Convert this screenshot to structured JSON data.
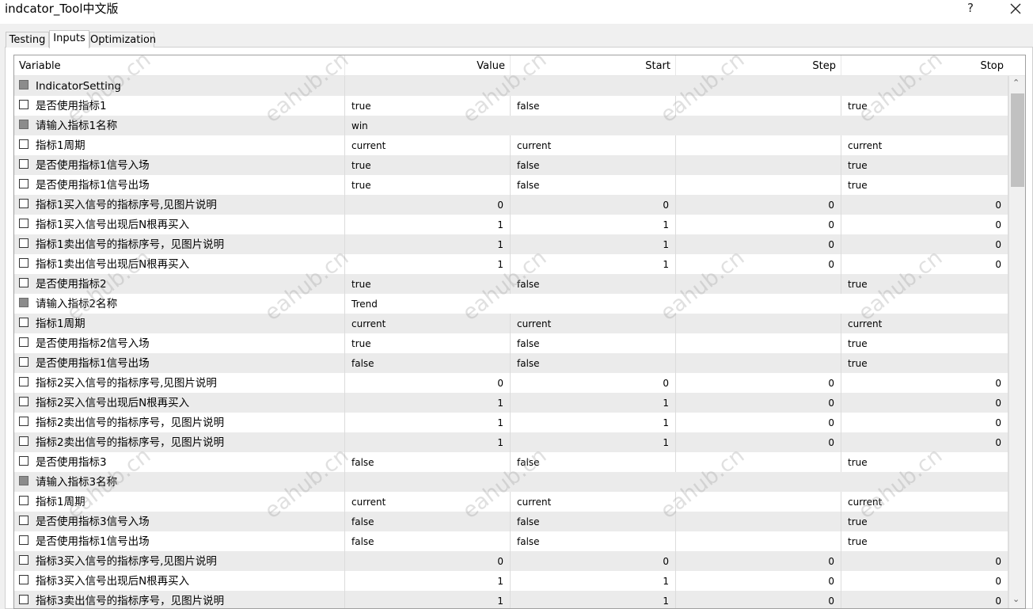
{
  "window": {
    "title": "indcator_Tool中文版",
    "help_label": "?"
  },
  "tabs": [
    {
      "label": "Testing"
    },
    {
      "label": "Inputs"
    },
    {
      "label": "Optimization"
    }
  ],
  "columns": [
    "Variable",
    "Value",
    "Start",
    "Step",
    "Stop"
  ],
  "rows": [
    {
      "kind": "group",
      "checkbox": "grey",
      "variable": "IndicatorSetting",
      "value": "",
      "start": "",
      "step": "",
      "stop": ""
    },
    {
      "kind": "text",
      "checkbox": "empty",
      "variable": "是否使用指标1",
      "value": "true",
      "start": "false",
      "step": "",
      "stop": "true"
    },
    {
      "kind": "group",
      "checkbox": "grey",
      "variable": "请输入指标1名称",
      "value": "win",
      "start": "",
      "step": "",
      "stop": ""
    },
    {
      "kind": "text",
      "checkbox": "empty",
      "variable": "指标1周期",
      "value": "current",
      "start": "current",
      "step": "",
      "stop": "current"
    },
    {
      "kind": "text",
      "checkbox": "empty",
      "variable": "是否使用指标1信号入场",
      "value": "true",
      "start": "false",
      "step": "",
      "stop": "true"
    },
    {
      "kind": "text",
      "checkbox": "empty",
      "variable": "是否使用指标1信号出场",
      "value": "true",
      "start": "false",
      "step": "",
      "stop": "true"
    },
    {
      "kind": "num",
      "checkbox": "empty",
      "variable": "指标1买入信号的指标序号,见图片说明",
      "value": "0",
      "start": "0",
      "step": "0",
      "stop": "0"
    },
    {
      "kind": "num",
      "checkbox": "empty",
      "variable": "指标1买入信号出现后N根再买入",
      "value": "1",
      "start": "1",
      "step": "0",
      "stop": "0"
    },
    {
      "kind": "num",
      "checkbox": "empty",
      "variable": "指标1卖出信号的指标序号，见图片说明",
      "value": "1",
      "start": "1",
      "step": "0",
      "stop": "0"
    },
    {
      "kind": "num",
      "checkbox": "empty",
      "variable": "指标1卖出信号出现后N根再买入",
      "value": "1",
      "start": "1",
      "step": "0",
      "stop": "0"
    },
    {
      "kind": "text",
      "checkbox": "empty",
      "variable": "是否使用指标2",
      "value": "true",
      "start": "false",
      "step": "",
      "stop": "true"
    },
    {
      "kind": "group",
      "checkbox": "grey",
      "variable": "请输入指标2名称",
      "value": "Trend",
      "start": "",
      "step": "",
      "stop": ""
    },
    {
      "kind": "text",
      "checkbox": "empty",
      "variable": "指标1周期",
      "value": "current",
      "start": "current",
      "step": "",
      "stop": "current"
    },
    {
      "kind": "text",
      "checkbox": "empty",
      "variable": "是否使用指标2信号入场",
      "value": "true",
      "start": "false",
      "step": "",
      "stop": "true"
    },
    {
      "kind": "text",
      "checkbox": "empty",
      "variable": "是否使用指标1信号出场",
      "value": "false",
      "start": "false",
      "step": "",
      "stop": "true"
    },
    {
      "kind": "num",
      "checkbox": "empty",
      "variable": "指标2买入信号的指标序号,见图片说明",
      "value": "0",
      "start": "0",
      "step": "0",
      "stop": "0"
    },
    {
      "kind": "num",
      "checkbox": "empty",
      "variable": "指标2买入信号出现后N根再买入",
      "value": "1",
      "start": "1",
      "step": "0",
      "stop": "0"
    },
    {
      "kind": "num",
      "checkbox": "empty",
      "variable": "指标2卖出信号的指标序号，见图片说明",
      "value": "1",
      "start": "1",
      "step": "0",
      "stop": "0"
    },
    {
      "kind": "num",
      "checkbox": "empty",
      "variable": "指标2卖出信号的指标序号，见图片说明",
      "value": "1",
      "start": "1",
      "step": "0",
      "stop": "0"
    },
    {
      "kind": "text",
      "checkbox": "empty",
      "variable": "是否使用指标3",
      "value": "false",
      "start": "false",
      "step": "",
      "stop": "true"
    },
    {
      "kind": "group",
      "checkbox": "grey",
      "variable": "请输入指标3名称",
      "value": "",
      "start": "",
      "step": "",
      "stop": ""
    },
    {
      "kind": "text",
      "checkbox": "empty",
      "variable": "指标1周期",
      "value": "current",
      "start": "current",
      "step": "",
      "stop": "current"
    },
    {
      "kind": "text",
      "checkbox": "empty",
      "variable": "是否使用指标3信号入场",
      "value": "false",
      "start": "false",
      "step": "",
      "stop": "true"
    },
    {
      "kind": "text",
      "checkbox": "empty",
      "variable": "是否使用指标1信号出场",
      "value": "false",
      "start": "false",
      "step": "",
      "stop": "true"
    },
    {
      "kind": "num",
      "checkbox": "empty",
      "variable": "指标3买入信号的指标序号,见图片说明",
      "value": "0",
      "start": "0",
      "step": "0",
      "stop": "0"
    },
    {
      "kind": "num",
      "checkbox": "empty",
      "variable": "指标3买入信号出现后N根再买入",
      "value": "1",
      "start": "1",
      "step": "0",
      "stop": "0"
    },
    {
      "kind": "num",
      "checkbox": "empty",
      "variable": "指标3卖出信号的指标序号，见图片说明",
      "value": "1",
      "start": "1",
      "step": "0",
      "stop": "0"
    }
  ],
  "watermark": "eahub.cn",
  "colors": {
    "alt_row": "#ebebeb",
    "grid_border": "#a0a0a0",
    "checkbox_grey": "#8c8c8c"
  }
}
